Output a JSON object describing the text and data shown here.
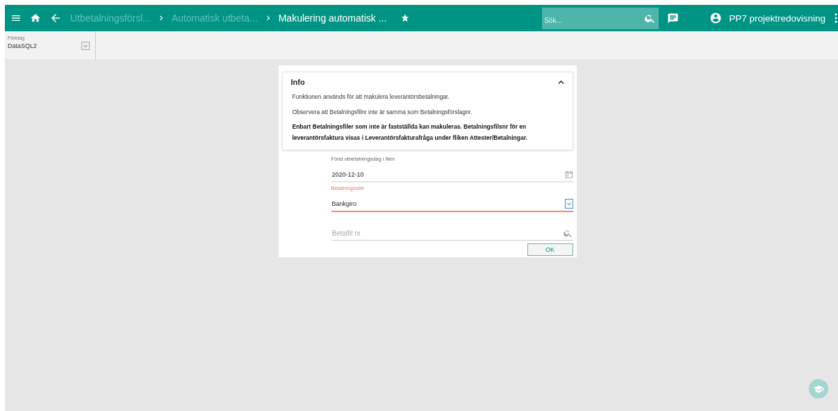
{
  "breadcrumbs": [
    {
      "label": "Utbetalningsförsl...",
      "current": false
    },
    {
      "label": "Automatisk utbeta...",
      "current": false
    },
    {
      "label": "Makulering automatisk ...",
      "current": true
    }
  ],
  "search": {
    "placeholder": "Sök..."
  },
  "user": {
    "name": "PP7 projektredovisning"
  },
  "company": {
    "label": "Företag",
    "value": "DataSQL2"
  },
  "info": {
    "title": "Info",
    "expanded": true,
    "paragraphs": [
      {
        "text": "Funktionen används för att makulera leverantörsbetalningar.",
        "bold": false
      },
      {
        "text": "Observera att Betalningsfilnr inte är samma som Betalningsförslagnr.",
        "bold": false
      },
      {
        "text": "Enbart Betalningsfiler som inte är fastställda kan makuleras. Betalningsfilsnr för en leverantörsfaktura visas i Leverantörsfakturafråga under fliken Attester/Betalningar.",
        "bold": true
      }
    ]
  },
  "fields": [
    {
      "kind": "date",
      "label": "Först utbetalningsdag i filen",
      "value": "2020-12-10",
      "focused": false
    },
    {
      "kind": "select",
      "label": "Betalningssätt",
      "value": "Bankgiro",
      "focused": true
    },
    {
      "kind": "search",
      "placeholder": "Betalfil nr",
      "focused": false
    }
  ],
  "ok_button": {
    "label": "OK"
  }
}
